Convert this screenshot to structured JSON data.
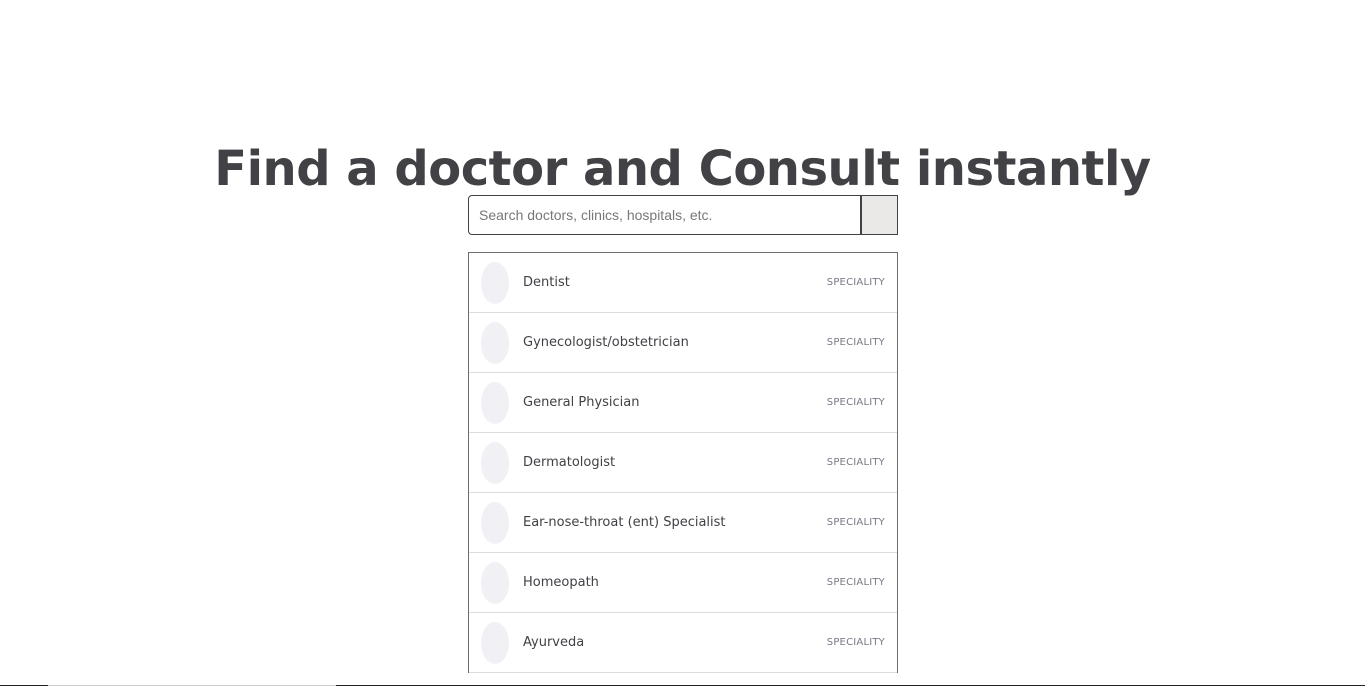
{
  "header": {
    "title": "Find a doctor and Consult instantly"
  },
  "search": {
    "placeholder": "Search doctors, clinics, hospitals, etc.",
    "value": ""
  },
  "results": [
    {
      "name": "Dentist",
      "type": "SPECIALITY"
    },
    {
      "name": "Gynecologist/obstetrician",
      "type": "SPECIALITY"
    },
    {
      "name": "General Physician",
      "type": "SPECIALITY"
    },
    {
      "name": "Dermatologist",
      "type": "SPECIALITY"
    },
    {
      "name": "Ear-nose-throat (ent) Specialist",
      "type": "SPECIALITY"
    },
    {
      "name": "Homeopath",
      "type": "SPECIALITY"
    },
    {
      "name": "Ayurveda",
      "type": "SPECIALITY"
    }
  ],
  "colors": {
    "title": "#414146",
    "avatar": "#f0f0f5",
    "search_button": "#ebe8e8"
  }
}
